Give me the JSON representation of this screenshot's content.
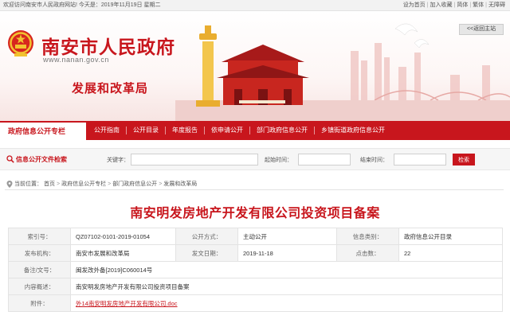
{
  "topbar": {
    "welcome": "欢迎访问南安市人民政府网站! 今天是：2019年11月19日 星期二",
    "links": [
      "设为首页",
      "加入收藏",
      "简体",
      "繁体",
      "无障碍"
    ]
  },
  "banner": {
    "site_title": "南安市人民政府",
    "site_domain": "www.nanan.gov.cn",
    "bureau": "发展和改革局",
    "back_home": "<<返回主站"
  },
  "nav": {
    "title": "政府信息公开专栏",
    "items": [
      "公开指南",
      "公开目录",
      "年度报告",
      "依申请公开",
      "部门政府信息公开",
      "乡镇街道政府信息公开"
    ]
  },
  "search": {
    "section_label": "信息公开文件检索",
    "keyword_label": "关键字：",
    "start_label": "起始时间：",
    "end_label": "结束时间：",
    "button": "检索"
  },
  "breadcrumb": {
    "prefix": "当前位置：",
    "items": [
      "首页",
      "政府信息公开专栏",
      "部门政府信息公开",
      "发展和改革局"
    ],
    "separator": ">"
  },
  "document": {
    "title": "南安明发房地产开发有限公司投资项目备案",
    "fields": {
      "index_label": "索引号：",
      "index_value": "QZ07102-0101-2019-01054",
      "method_label": "公开方式：",
      "method_value": "主动公开",
      "category_label": "信息类别：",
      "category_value": "政府信息公开目录",
      "issuer_label": "发布机构：",
      "issuer_value": "南安市发展和改革局",
      "date_label": "发文日期：",
      "date_value": "2019-11-18",
      "clicks_label": "点击数：",
      "clicks_value": "22",
      "docno_label": "备注/文号：",
      "docno_value": "闽发改外备[2019]C060014号",
      "summary_label": "内容概述：",
      "summary_value": "南安明发房地产开发有限公司投资项目备案",
      "attachment_label": "附件：",
      "attachment_value": "外14南安明发房地产开发有限公司.doc"
    }
  },
  "colors": {
    "brand_red": "#c8161d"
  }
}
